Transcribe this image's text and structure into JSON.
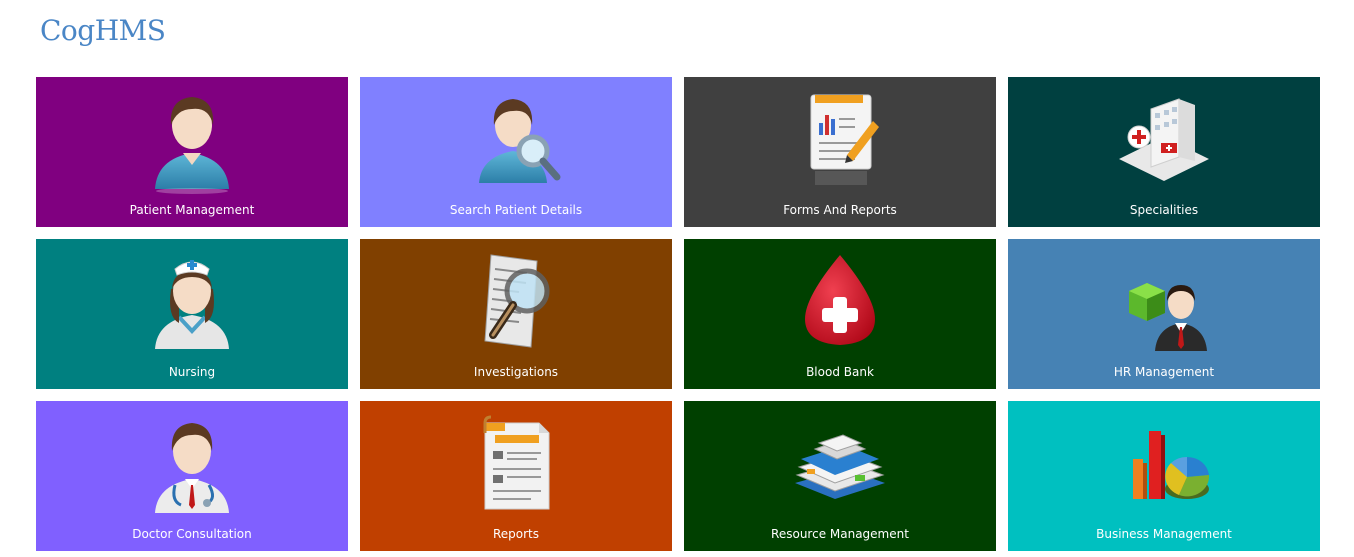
{
  "app": {
    "title": "CogHMS"
  },
  "tiles": [
    {
      "label": "Patient Management",
      "color": "#800080",
      "icon": "patient-icon"
    },
    {
      "label": "Search Patient Details",
      "color": "#8080ff",
      "icon": "search-patient-icon"
    },
    {
      "label": "Forms And Reports",
      "color": "#404040",
      "icon": "forms-report-icon"
    },
    {
      "label": "Specialities",
      "color": "#004040",
      "icon": "hospital-icon"
    },
    {
      "label": "Nursing",
      "color": "#008080",
      "icon": "nurse-icon"
    },
    {
      "label": "Investigations",
      "color": "#804000",
      "icon": "investigation-icon"
    },
    {
      "label": "Blood Bank",
      "color": "#004000",
      "icon": "blood-drop-icon"
    },
    {
      "label": "HR Management",
      "color": "#4682b4",
      "icon": "hr-icon"
    },
    {
      "label": "Doctor Consultation",
      "color": "#8060ff",
      "icon": "doctor-icon"
    },
    {
      "label": "Reports",
      "color": "#c04000",
      "icon": "report-document-icon"
    },
    {
      "label": "Resource Management",
      "color": "#004000",
      "icon": "resource-files-icon"
    },
    {
      "label": "Business Management",
      "color": "#00c0c0",
      "icon": "business-chart-icon"
    }
  ]
}
